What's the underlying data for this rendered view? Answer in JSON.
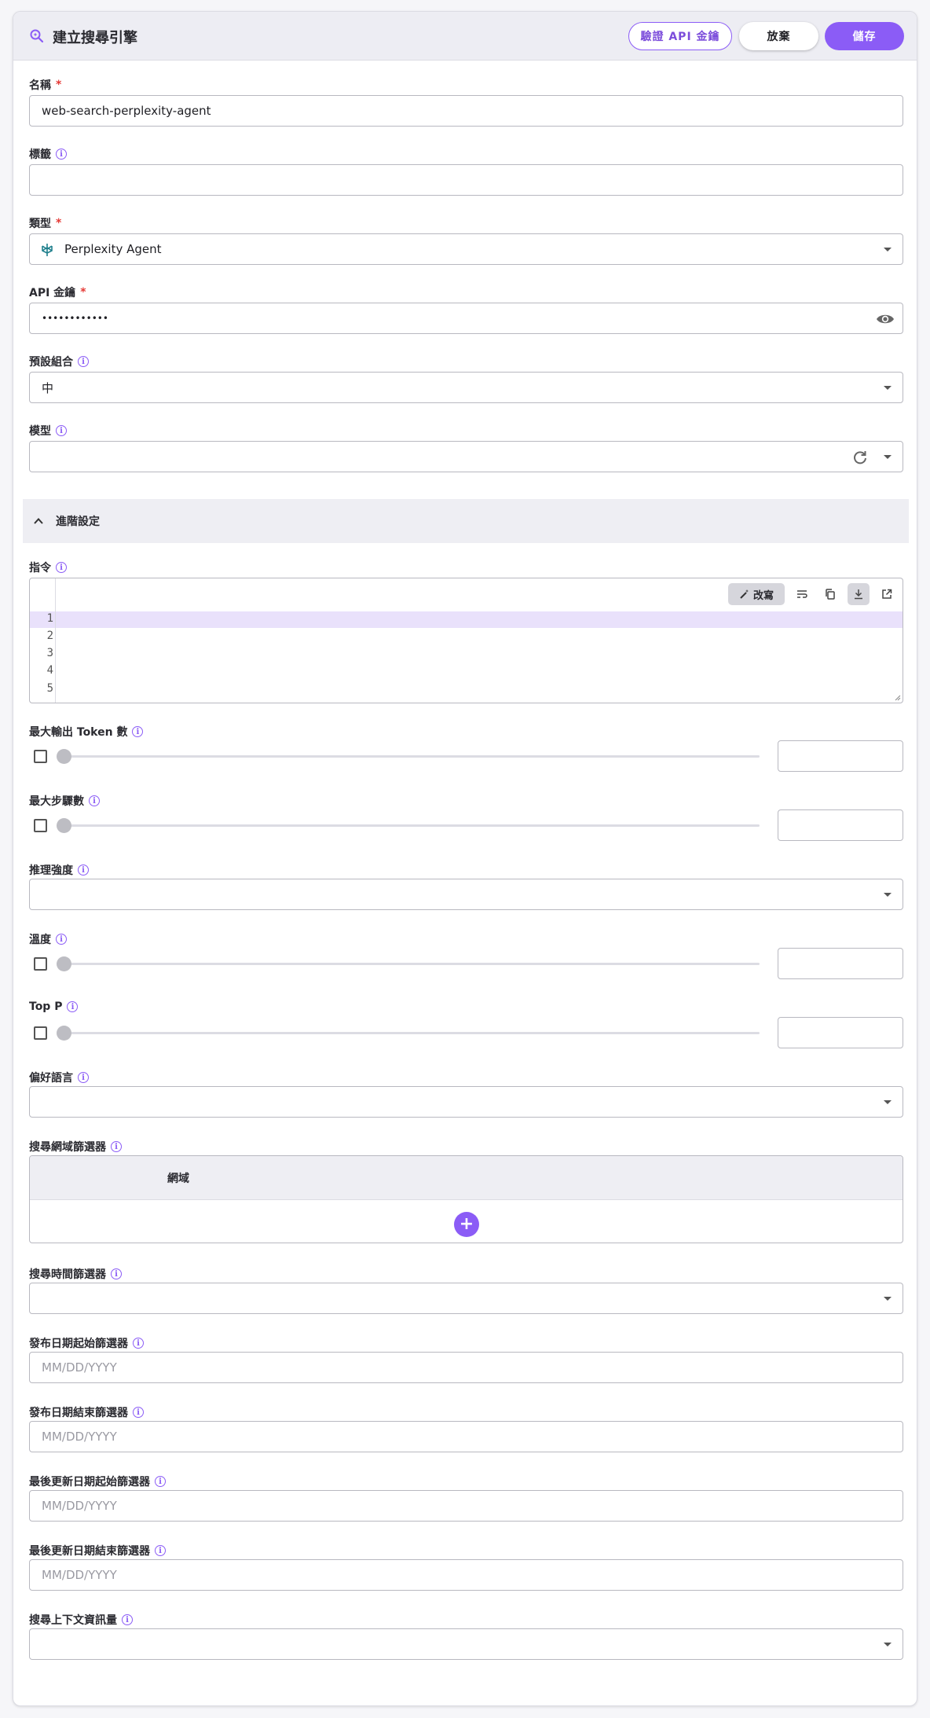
{
  "header": {
    "title": "建立搜尋引擎",
    "verify_label": "驗證 API 金鑰",
    "discard_label": "放棄",
    "save_label": "儲存"
  },
  "fields": {
    "name": {
      "label": "名稱",
      "required_mark": "*",
      "value": "web-search-perplexity-agent"
    },
    "tags": {
      "label": "標籤",
      "value": ""
    },
    "type": {
      "label": "類型",
      "required_mark": "*",
      "value": "Perplexity Agent"
    },
    "api_key": {
      "label": "API 金鑰",
      "required_mark": "*",
      "value": "••••••••••••"
    },
    "preset": {
      "label": "預設組合",
      "value": "中"
    },
    "model": {
      "label": "模型",
      "value": ""
    }
  },
  "advanced": {
    "title": "進階設定",
    "instructions": {
      "label": "指令",
      "improve_label": "改寫",
      "line_numbers": [
        "1",
        "2",
        "3",
        "4",
        "5"
      ]
    },
    "max_tokens": {
      "label": "最大輸出 Token 數",
      "value": "",
      "enabled": false
    },
    "max_steps": {
      "label": "最大步驟數",
      "value": "",
      "enabled": false
    },
    "reasoning": {
      "label": "推理強度",
      "value": ""
    },
    "temperature": {
      "label": "溫度",
      "value": "",
      "enabled": false
    },
    "top_p": {
      "label": "Top P",
      "value": "",
      "enabled": false
    },
    "language": {
      "label": "偏好語言",
      "value": ""
    },
    "domain_filter": {
      "label": "搜尋網域篩選器",
      "column": "網域",
      "add_label": "+"
    },
    "time_filter": {
      "label": "搜尋時間篩選器",
      "value": ""
    },
    "published_after": {
      "label": "發布日期起始篩選器",
      "placeholder": "MM/DD/YYYY"
    },
    "published_before": {
      "label": "發布日期結束篩選器",
      "placeholder": "MM/DD/YYYY"
    },
    "updated_after": {
      "label": "最後更新日期起始篩選器",
      "placeholder": "MM/DD/YYYY"
    },
    "updated_before": {
      "label": "最後更新日期結束篩選器",
      "placeholder": "MM/DD/YYYY"
    },
    "context_size": {
      "label": "搜尋上下文資訊量",
      "value": ""
    }
  },
  "colors": {
    "accent": "#8b5cf6",
    "required": "#e53935",
    "highlight": "#e9e1fb"
  },
  "icons": {
    "header": "search-sparkle-icon",
    "info": "info-icon",
    "visibility": "eye-icon",
    "refresh": "refresh-icon",
    "dropdown": "caret-down-icon",
    "collapse": "chevron-up-icon",
    "type_logo": "perplexity-logo-icon"
  }
}
